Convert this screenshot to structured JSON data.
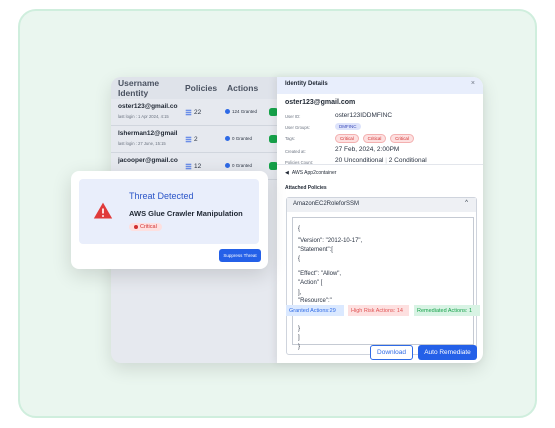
{
  "table": {
    "headers": [
      "Username Identity",
      "Policies",
      "Actions"
    ],
    "rows": [
      {
        "email": "oster123@gmail.com",
        "login": "last login : 1 Apr 2024, 4:15",
        "policies": "22",
        "actions": "124 Granted"
      },
      {
        "email": "lsherman12@gmail....",
        "login": "last login : 27 June, 15:15",
        "policies": "2",
        "actions": "0 Granted"
      },
      {
        "email": "jacooper@gmail.com",
        "login": "",
        "policies": "12",
        "actions": "0 Granted"
      }
    ]
  },
  "details": {
    "title": "Identity Details",
    "close": "×",
    "email": "oster123@gmail.com",
    "labels": {
      "user_id": "User ID:",
      "user_groups": "User Groups:",
      "tags": "Tags:",
      "created": "Created at:",
      "policies_count": "Policies Count:"
    },
    "user_id": "oster123IDDMFINC",
    "group": "DMFINC",
    "tags": [
      "Critical",
      "Critical",
      "Critical"
    ],
    "created_at": "27 Feb, 2024, 2:00PM",
    "policies_count": "20 Unconditional",
    "policies_conditional": "2 Conditional",
    "container": "AWS App2container",
    "attached": "Attached Policies",
    "policy_name": "AmazonEC2RoleforSSM",
    "code": [
      "{",
      "\"Version\": \"2012-10-17\",",
      "\"Statement\":[",
      "{",
      "\"Effect\": \"Allow\",",
      "\"Action\" [",
      "],",
      "\"Resource\":\"",
      "}",
      "]",
      "}"
    ],
    "stats": {
      "granted": "Granted Actions:29",
      "risk": "High Risk Actions: 14",
      "remediated": "Remediated Actions: 1"
    },
    "download": "Download",
    "remediate": "Auto Remediate"
  },
  "threat": {
    "title": "Threat Detected",
    "name": "AWS Glue Crawler Manipulation",
    "badge": "Critical",
    "suppress": "Suppress Threat"
  },
  "colors": {
    "accent": "#2460e8",
    "critical": "#d12f2f",
    "success": "#16a34a",
    "outer_bg": "#eaf6ef"
  }
}
